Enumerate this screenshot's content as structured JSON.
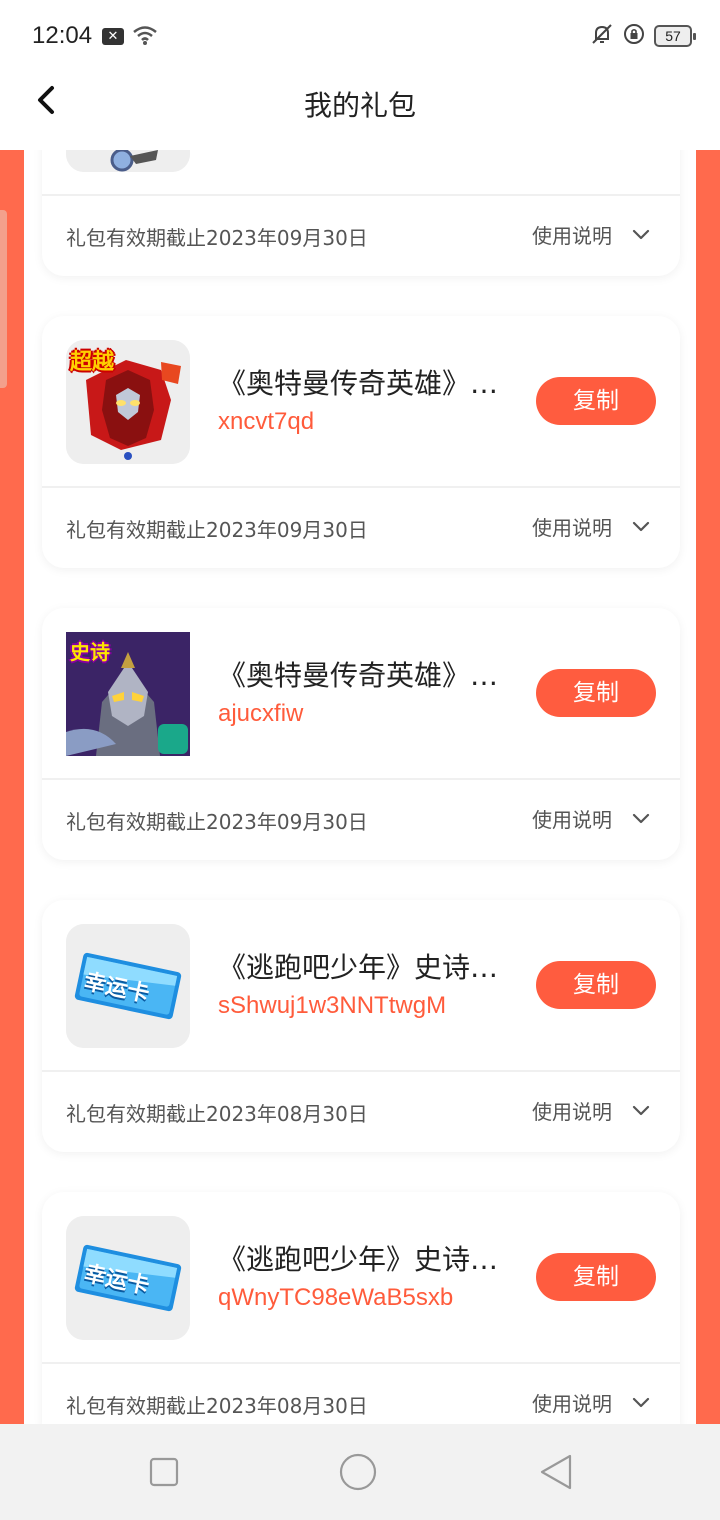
{
  "status": {
    "time": "12:04",
    "notif_icon": "x-icon",
    "battery": "57"
  },
  "header": {
    "title": "我的礼包"
  },
  "cards": [
    {
      "name": "",
      "code": "",
      "expire": "礼包有效期截止2023年09月30日",
      "usage_label": "使用说明"
    },
    {
      "name": "《奥特曼传奇英雄》…",
      "code": "xncvt7qd",
      "copy_label": "复制",
      "expire": "礼包有效期截止2023年09月30日",
      "usage_label": "使用说明",
      "icon_text": "超越"
    },
    {
      "name": "《奥特曼传奇英雄》…",
      "code": "ajucxfiw",
      "copy_label": "复制",
      "expire": "礼包有效期截止2023年09月30日",
      "usage_label": "使用说明",
      "icon_text": "史诗"
    },
    {
      "name": "《逃跑吧少年》史诗…",
      "code": "sShwuj1w3NNTtwgM",
      "copy_label": "复制",
      "expire": "礼包有效期截止2023年08月30日",
      "usage_label": "使用说明",
      "icon_text": "幸运卡"
    },
    {
      "name": "《逃跑吧少年》史诗…",
      "code": "qWnyTC98eWaB5sxb",
      "copy_label": "复制",
      "expire": "礼包有效期截止2023年08月30日",
      "usage_label": "使用说明",
      "icon_text": "幸运卡"
    }
  ],
  "colors": {
    "accent": "#ff5c3f",
    "side": "#ff6a4d",
    "code": "#ff5b3b"
  }
}
